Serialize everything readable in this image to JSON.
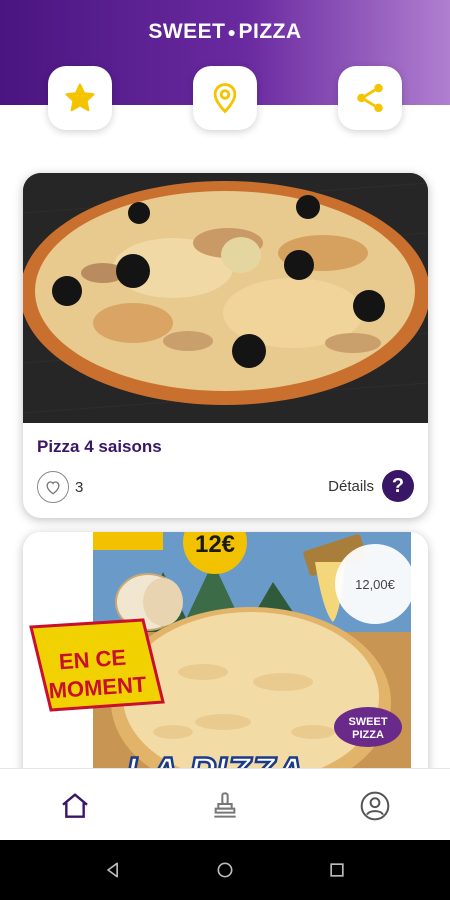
{
  "app": {
    "logo_left": "SWEET",
    "logo_right": "PIZZA"
  },
  "header": {
    "actions": [
      {
        "icon": "star-icon",
        "color": "#f5c400"
      },
      {
        "icon": "location-pin-icon",
        "color": "#f5c400"
      },
      {
        "icon": "share-icon",
        "color": "#f5c400"
      }
    ]
  },
  "cards": [
    {
      "title": "Pizza 4 saisons",
      "likes": "3",
      "details_label": "Détails",
      "help_symbol": "?"
    },
    {
      "price": "12,00€",
      "promo": {
        "price_badge": "12€",
        "banner_line1": "EN CE",
        "banner_line2": "MOMENT",
        "headline": "LA PIZZA",
        "brand_line1": "SWEET",
        "brand_line2": "PIZZA"
      }
    }
  ],
  "bottom_nav": {
    "items": [
      "home-icon",
      "stamp-icon",
      "profile-icon"
    ]
  },
  "colors": {
    "brand_purple": "#3a1666",
    "gradient_start": "#4a1580",
    "gradient_end": "#b07fd0",
    "accent_yellow": "#f5c400"
  }
}
